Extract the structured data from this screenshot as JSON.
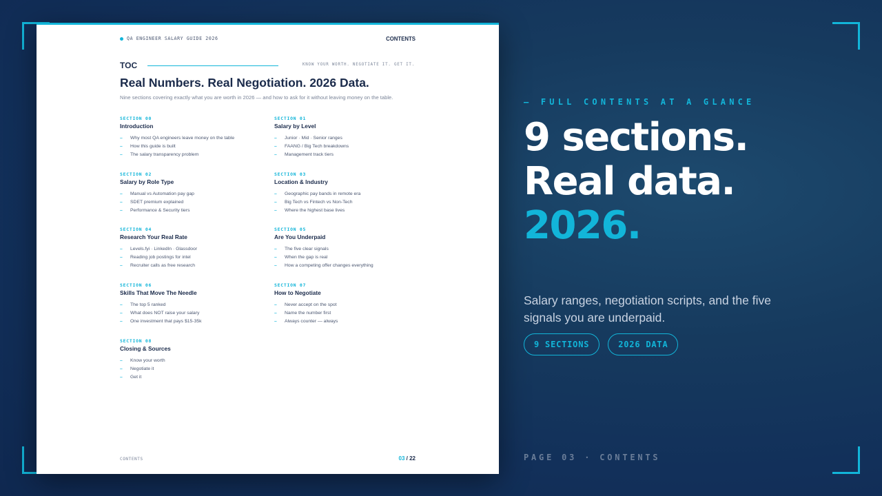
{
  "document": {
    "brand": "QA ENGINEER SALARY GUIDE 2026",
    "header_section": "CONTENTS",
    "toc_label": "TOC",
    "tagline": "KNOW YOUR WORTH. NEGOTIATE IT. GET IT.",
    "title": "Real Numbers. Real Negotiation. 2026 Data.",
    "intro": "Nine sections covering exactly what you are worth in 2026 — and how to ask for it without leaving money on the table.",
    "sections": [
      {
        "num": "SECTION 00",
        "title": "Introduction",
        "items": [
          "Why most QA engineers leave money on the table",
          "How this guide is built",
          "The salary transparency problem"
        ]
      },
      {
        "num": "SECTION 01",
        "title": "Salary by Level",
        "items": [
          "Junior · Mid · Senior ranges",
          "FAANG / Big Tech breakdowns",
          "Management track tiers"
        ]
      },
      {
        "num": "SECTION 02",
        "title": "Salary by Role Type",
        "items": [
          "Manual vs Automation pay gap",
          "SDET premium explained",
          "Performance & Security tiers"
        ]
      },
      {
        "num": "SECTION 03",
        "title": "Location & Industry",
        "items": [
          "Geographic pay bands in remote era",
          "Big Tech vs Fintech vs Non-Tech",
          "Where the highest base lives"
        ]
      },
      {
        "num": "SECTION 04",
        "title": "Research Your Real Rate",
        "items": [
          "Levels.fyi · LinkedIn · Glassdoor",
          "Reading job postings for intel",
          "Recruiter calls as free research"
        ]
      },
      {
        "num": "SECTION 05",
        "title": "Are You Underpaid",
        "items": [
          "The five clear signals",
          "When the gap is real",
          "How a competing offer changes everything"
        ]
      },
      {
        "num": "SECTION 06",
        "title": "Skills That Move The Needle",
        "items": [
          "The top 5 ranked",
          "What does NOT raise your salary",
          "One investment that pays $15-35k"
        ]
      },
      {
        "num": "SECTION 07",
        "title": "How to Negotiate",
        "items": [
          "Never accept on the spot",
          "Name the number first",
          "Always counter — always"
        ]
      },
      {
        "num": "SECTION 08",
        "title": "Closing & Sources",
        "items": [
          "Know your worth",
          "Negotiate it",
          "Get it"
        ]
      }
    ],
    "footer_label": "CONTENTS",
    "page_current": "03",
    "page_total": "/ 22"
  },
  "panel": {
    "eyebrow": "— FULL CONTENTS AT A GLANCE",
    "headline_line1": "9 sections.",
    "headline_line2": "Real data.",
    "headline_accent": "2026.",
    "subtext": "Salary ranges, negotiation scripts, and the five signals you are underpaid.",
    "chips": [
      "9 SECTIONS",
      "2026 DATA"
    ],
    "page_label": "PAGE 03 · CONTENTS"
  },
  "colors": {
    "accent": "#12b5d9",
    "navy": "#1b2b4b",
    "background": "#163a5e"
  }
}
